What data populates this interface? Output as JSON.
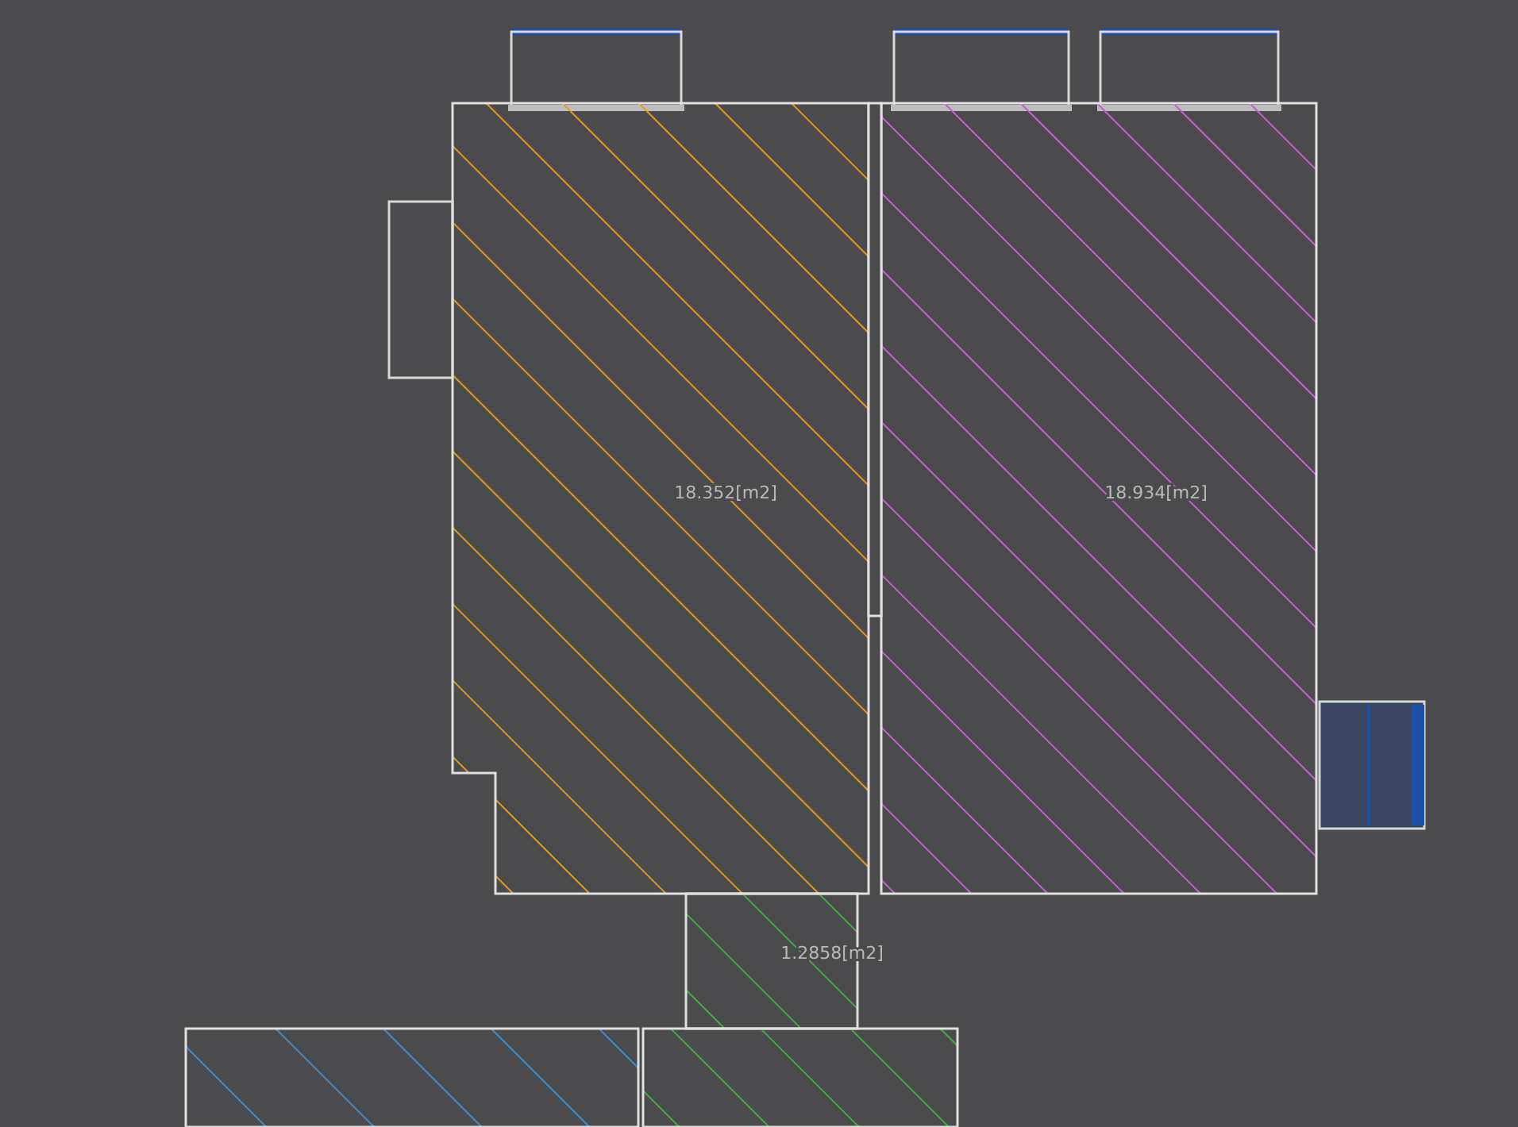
{
  "rooms": [
    {
      "area": "18.352[m2]",
      "color": "#e8961e"
    },
    {
      "area": "18.934[m2]",
      "color": "#c35fd0"
    },
    {
      "area": "1.2858[m2]",
      "color": "#3fae3f"
    },
    {
      "color": "#3a8ed0"
    },
    {
      "color": "#3fae3f"
    }
  ]
}
